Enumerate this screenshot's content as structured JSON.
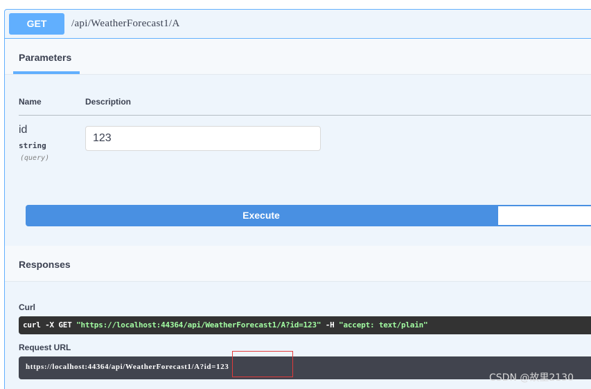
{
  "operation": {
    "method": "GET",
    "path": "/api/WeatherForecast1/A"
  },
  "parameters": {
    "title": "Parameters",
    "columns": {
      "name": "Name",
      "description": "Description"
    },
    "items": [
      {
        "name": "id",
        "type": "string",
        "in": "(query)",
        "value": "123"
      }
    ]
  },
  "execute": {
    "label": "Execute"
  },
  "responses": {
    "title": "Responses",
    "curl_label": "Curl",
    "curl_prefix": "curl -X GET ",
    "curl_url": "\"https://localhost:44364/api/WeatherForecast1/A?id=123\"",
    "curl_flag": " -H ",
    "curl_header": "\"accept: text/plain\"",
    "request_url_label": "Request URL",
    "request_url": "https://localhost:44364/api/WeatherForecast1/A?id=123"
  },
  "watermark": "CSDN @故里2130",
  "colors": {
    "get_accent": "#61affe",
    "execute": "#4990e2",
    "highlight": "#e23b3b"
  }
}
